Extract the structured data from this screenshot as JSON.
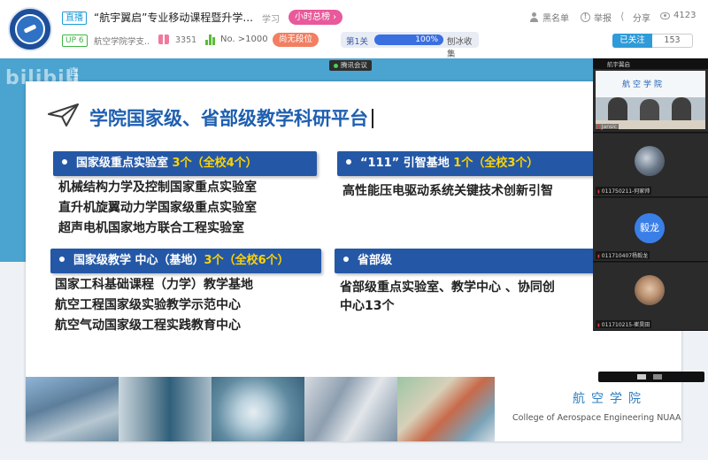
{
  "header": {
    "live_tag": "直播",
    "room_title": "“航宇翼启”专业移动课程暨升学...",
    "area": "学习",
    "rank_button": "小时总榜 ›",
    "actions": [
      {
        "icon": "blacklist-user-icon",
        "label": "黑名单"
      },
      {
        "icon": "report-icon",
        "label": "举报"
      },
      {
        "icon": "share-icon",
        "label": "分享"
      },
      {
        "icon": "viewers-icon",
        "label": "4123"
      }
    ],
    "up_level": "UP 6",
    "host_name": "航空学院学支...",
    "gift_count": "3351",
    "rank_no": "No. >1000",
    "guard_button": "尚无段位",
    "level_label": "第1关",
    "level_percent": "100%",
    "level_progress": 1.0,
    "level_name": "刨冰收集",
    "follow_button": "已关注",
    "follower_count": "153"
  },
  "player": {
    "watermark": "bilibili",
    "watermark_sub": "直播",
    "meeting_badge": "腾讯会议"
  },
  "slide": {
    "title": "学院国家级、省部级教学科研平台",
    "sections": [
      {
        "prefix": "国家级重点实验室 ",
        "highlight": "3个（全校4个）",
        "lines": [
          "机械结构力学及控制国家重点实验室",
          "直升机旋翼动力学国家级重点实验室",
          "超声电机国家地方联合工程实验室"
        ]
      },
      {
        "prefix": "“111” 引智基地 ",
        "highlight": "1个（全校3个）",
        "lines": [
          "高性能压电驱动系统关键技术创新引智"
        ]
      },
      {
        "prefix": "国家级教学 中心（基地）",
        "highlight": "3个（全校6个）",
        "lines": [
          "国家工科基础课程（力学）教学基地",
          "航空工程国家级实验教学示范中心",
          "航空气动国家级工程实践教育中心"
        ]
      },
      {
        "prefix": "省部级",
        "highlight": "",
        "lines": [
          "省部级重点实验室、教学中心 、协同创",
          "中心13个"
        ]
      }
    ],
    "college_cn": "航空学院",
    "college_en": "College of Aerospace Engineering NUAA"
  },
  "gallery": {
    "top_label": "航宇翼启",
    "tiles": [
      {
        "label": "Jansic",
        "kind": "room",
        "banner": "航空学院"
      },
      {
        "label": "011750211-何家帅",
        "kind": "avatar-photo"
      },
      {
        "label": "011710407杨毅龙",
        "kind": "avatar-text",
        "text": "毅龙"
      },
      {
        "label": "011710215-崔昊田",
        "kind": "avatar-face"
      }
    ]
  },
  "colors": {
    "accent_blue": "#2458a6",
    "highlight_yellow": "#ffd400",
    "title_blue": "#1e5fb0",
    "player_bg": "#4ba3cf"
  }
}
